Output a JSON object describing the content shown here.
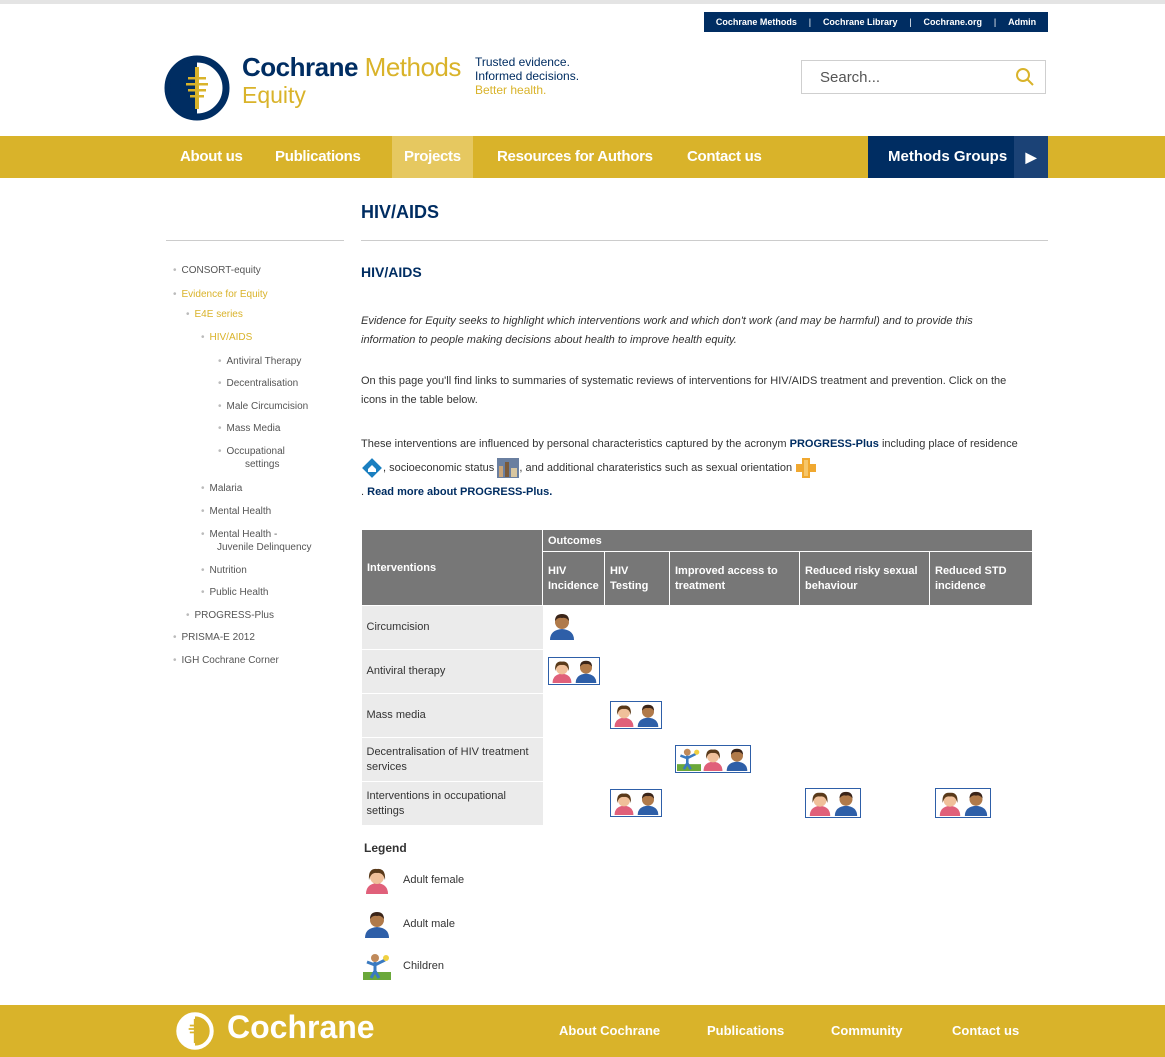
{
  "util_nav": [
    "Cochrane Methods",
    "Cochrane Library",
    "Cochrane.org",
    "Admin"
  ],
  "header": {
    "brand_primary": "Cochrane",
    "brand_secondary": "Methods",
    "brand_sub": "Equity",
    "tagline_1": "Trusted evidence.",
    "tagline_2": "Informed decisions.",
    "tagline_3": "Better health.",
    "search_placeholder": "Search..."
  },
  "nav": {
    "items": [
      "About us",
      "Publications",
      "Projects",
      "Resources for Authors",
      "Contact us"
    ],
    "active": "Projects",
    "methods_groups": "Methods Groups"
  },
  "page_title": "HIV/AIDS",
  "sidebar": [
    "CONSORT-equity",
    "Evidence for Equity",
    "E4E series",
    "HIV/AIDS",
    "Antiviral Therapy",
    "Decentralisation",
    "Male Circumcision",
    "Mass Media",
    "Occupational",
    "settings",
    "Malaria",
    "Mental Health",
    "Mental Health -",
    "Juvenile Delinquency",
    "Nutrition",
    "Public Health",
    "PROGRESS-Plus",
    "PRISMA-E 2012",
    "IGH Cochrane Corner"
  ],
  "content": {
    "heading": "HIV/AIDS",
    "intro": "Evidence for Equity seeks to highlight which interventions work and which don't work (and may be harmful) and to provide this information to people making decisions about health to improve health equity.",
    "para2": "On this page you'll find links to summaries of systematic reviews of interventions for HIV/AIDS treatment and prevention. Click on the icons in the table below.",
    "para3_a": "These interventions are influenced by personal characteristics captured by the acronym",
    "para3_link": "PROGRESS-Plus",
    "para3_b": "including place of residence",
    "para3_c": ", socioeconomic status",
    "para3_d": ", and additional charateristics such as sexual orientation",
    "para3_e": ".",
    "read_more": "Read more about PROGRESS-Plus."
  },
  "table": {
    "interventions_header": "Interventions",
    "outcomes_header": "Outcomes",
    "columns": [
      "HIV Incidence",
      "HIV Testing",
      "Improved access to treatment",
      "Reduced risky sexual behaviour",
      "Reduced STD incidence"
    ],
    "rows": [
      "Circumcision",
      "Antiviral therapy",
      "Mass media",
      "Decentralisation of HIV treatment services",
      "Interventions in occupational settings"
    ]
  },
  "legend": {
    "title": "Legend",
    "items": [
      "Adult female",
      "Adult male",
      "Children"
    ]
  },
  "footer": {
    "brand": "Cochrane",
    "links": [
      "About Cochrane",
      "Publications",
      "Community",
      "Contact us"
    ]
  },
  "colors": {
    "navy": "#002d62",
    "gold": "#d9b32a",
    "table_header": "#777777"
  }
}
